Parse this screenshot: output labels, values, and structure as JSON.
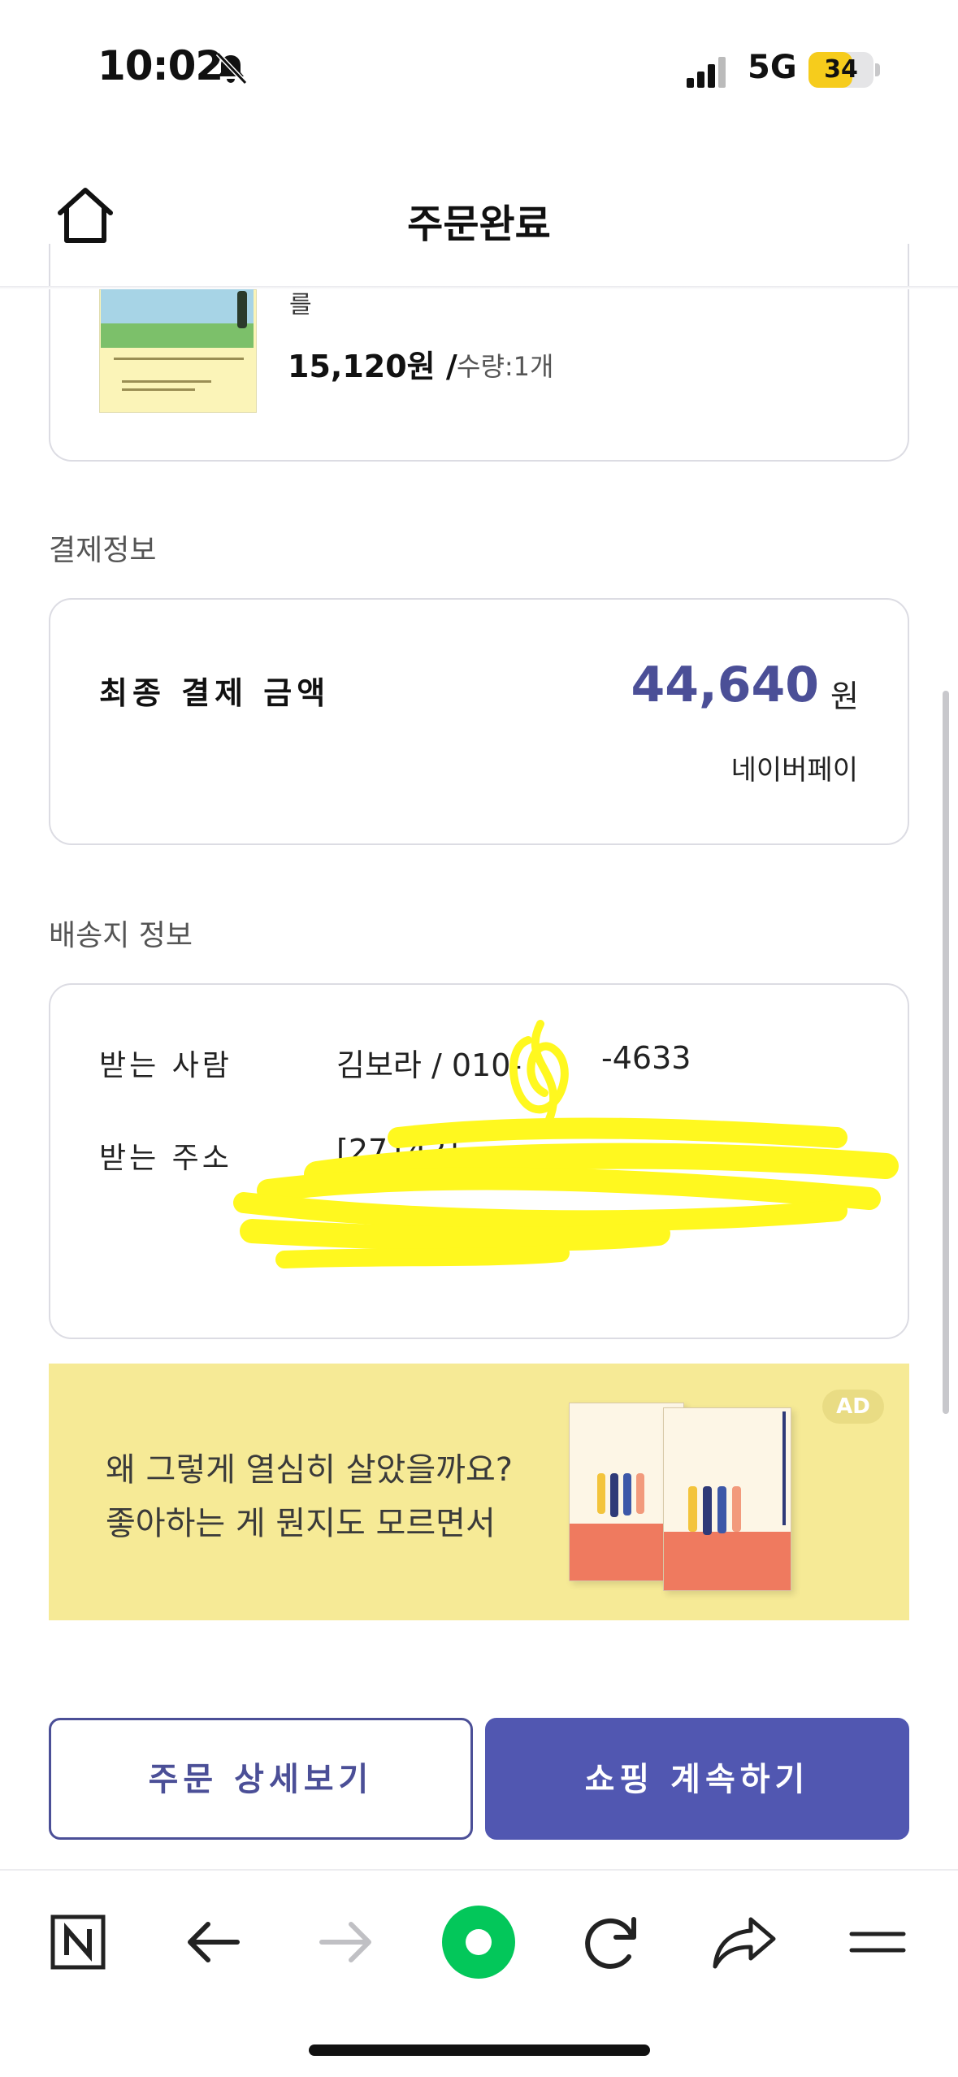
{
  "status_bar": {
    "time": "10:02",
    "network": "5G",
    "battery": "34",
    "icons": [
      "bell-slash-icon",
      "signal-icon",
      "battery-icon"
    ]
  },
  "header": {
    "title": "주문완료",
    "home_icon": "home-icon"
  },
  "product": {
    "name_fragment": "를",
    "price": "15,120원 /",
    "quantity": "수량:1개"
  },
  "payment": {
    "section_title": "결제정보",
    "total_label": "최종 결제 금액",
    "amount": "44,640",
    "currency": "원",
    "method": "네이버페이",
    "accent_color": "#4b4f97"
  },
  "shipping": {
    "section_title": "배송지 정보",
    "recipient_label": "받는 사람",
    "recipient_value": "김보라 / 010-",
    "recipient_phone_tail": "-4633",
    "address_label": "받는 주소",
    "address_value": "[27142]"
  },
  "ad": {
    "line1": "왜 그렇게 열심히 살았을까요?",
    "line2": "좋아하는 게 뭔지도 모르면서",
    "badge": "AD",
    "background": "#f6ea96"
  },
  "buttons": {
    "order_detail": "주문 상세보기",
    "continue_shopping": "쇼핑 계속하기",
    "primary_color": "#5157b1"
  },
  "toolbar": {
    "items": [
      "naver-icon",
      "back-arrow-icon",
      "forward-arrow-icon",
      "green-dot-icon",
      "reload-icon",
      "share-icon",
      "menu-icon"
    ],
    "accent": "#03c75a"
  }
}
